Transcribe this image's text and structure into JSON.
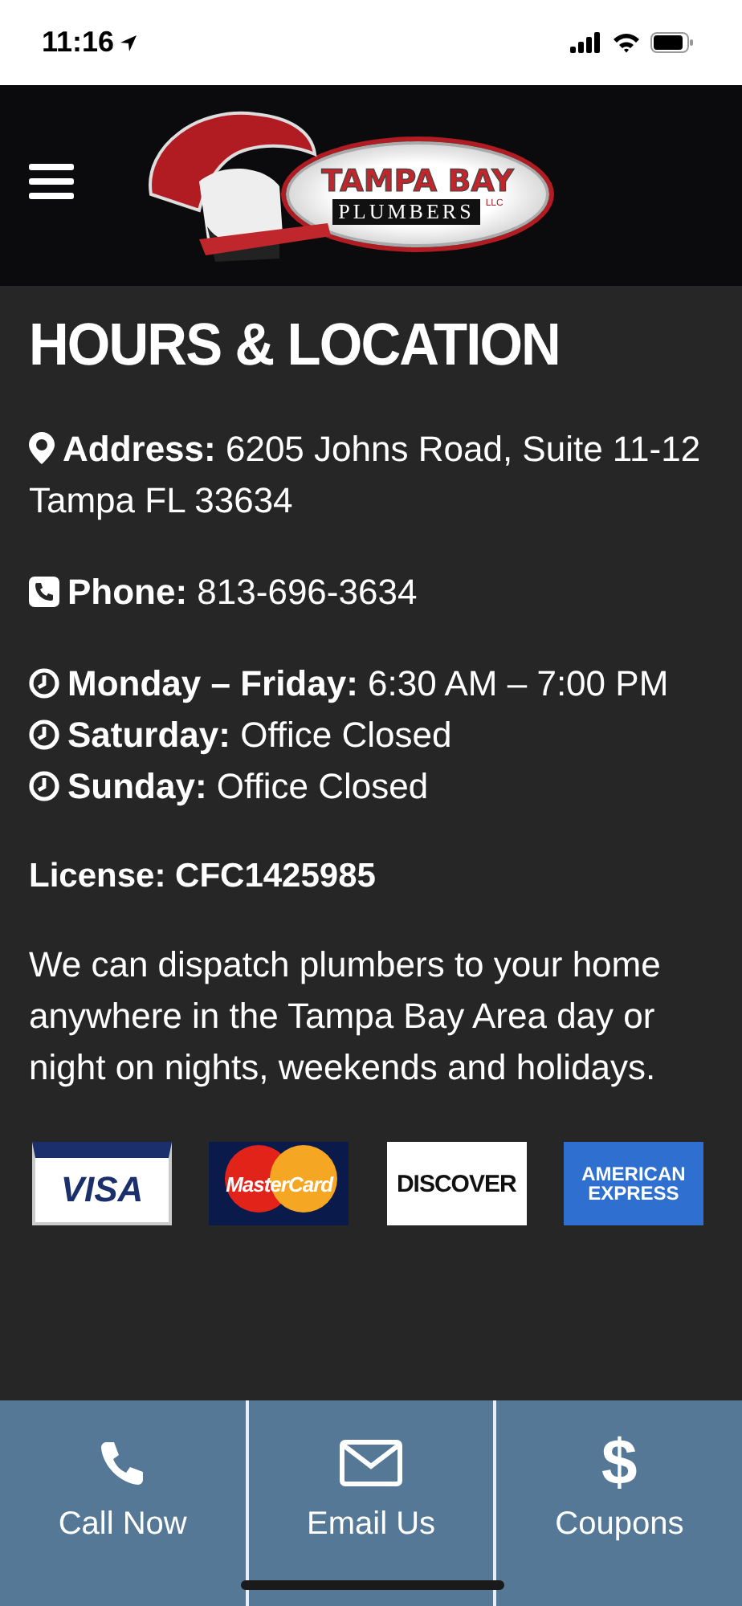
{
  "status_bar": {
    "time": "11:16"
  },
  "header": {
    "logo": {
      "line_1": "TAMPA BAY",
      "line_2": "PLUMBERS",
      "suffix": "LLC"
    }
  },
  "page": {
    "title": "HOURS & LOCATION",
    "address": {
      "label": "Address:",
      "lines": [
        "6205 Johns Road, Suite 11-12",
        "Tampa FL 33634"
      ]
    },
    "phone": {
      "label": "Phone:",
      "value": "813-696-3634"
    },
    "hours": [
      {
        "label": "Monday – Friday:",
        "value": "6:30 AM – 7:00 PM"
      },
      {
        "label": "Saturday:",
        "value": "Office Closed"
      },
      {
        "label": "Sunday:",
        "value": "Office Closed"
      }
    ],
    "license": "License: CFC1425985",
    "note": "We can dispatch plumbers to your home anywhere in the Tampa Bay Area day or night on nights, weekends and holidays.",
    "payment_cards": [
      {
        "kind": "visa",
        "label": "VISA"
      },
      {
        "kind": "mastercard",
        "label": "MasterCard"
      },
      {
        "kind": "discover",
        "label": "DISCOVER"
      },
      {
        "kind": "amex",
        "label": "AMERICAN EXPRESS"
      }
    ]
  },
  "bottom_nav": [
    {
      "kind": "phone",
      "label": "Call Now"
    },
    {
      "kind": "email",
      "label": "Email Us"
    },
    {
      "kind": "text",
      "icon_text": "$",
      "label": "Coupons"
    }
  ]
}
